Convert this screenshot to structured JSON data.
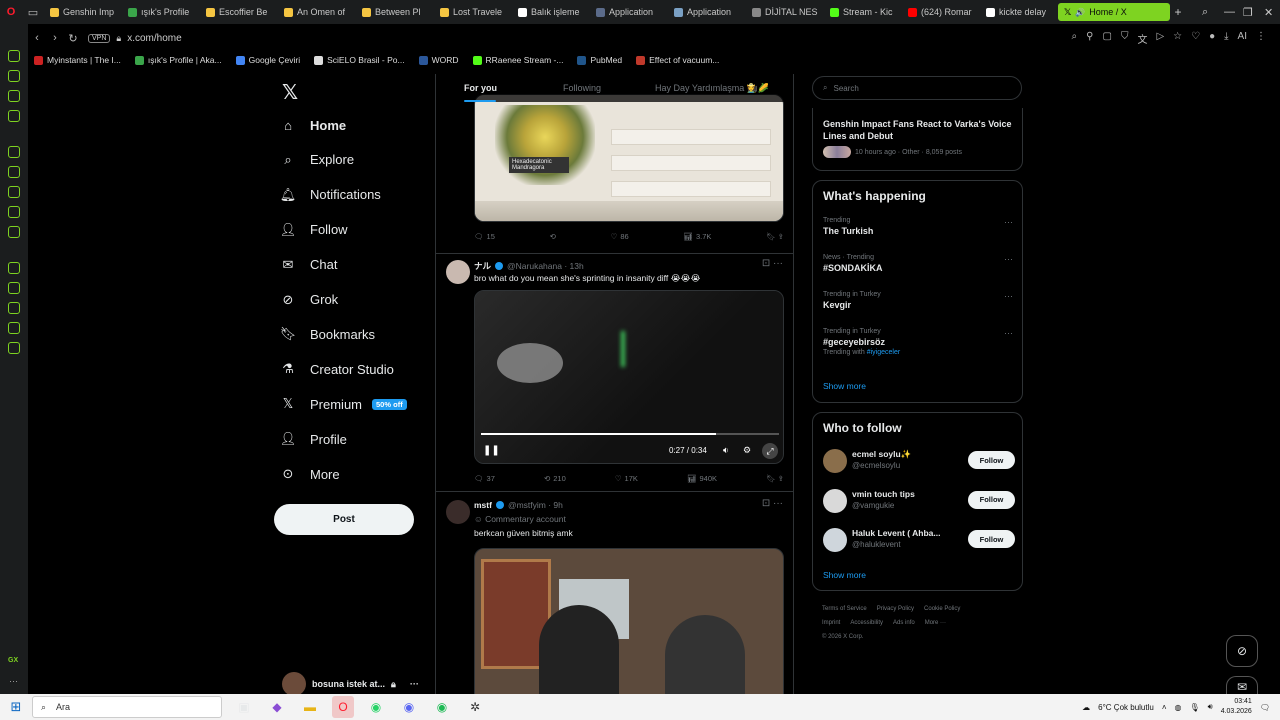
{
  "browser": {
    "tabs": [
      {
        "label": "Genshin Imp",
        "color": "#f5c542"
      },
      {
        "label": "ışık's Profile",
        "color": "#3aa54a"
      },
      {
        "label": "Escoffier Be",
        "color": "#f5c542"
      },
      {
        "label": "An Omen of",
        "color": "#f5c542"
      },
      {
        "label": "Between Pl",
        "color": "#f5c542"
      },
      {
        "label": "Lost Travele",
        "color": "#f5c542"
      },
      {
        "label": "Balık işleme",
        "color": "#ffffff"
      },
      {
        "label": "Application",
        "color": "#5b6b8a"
      },
      {
        "label": "Application",
        "color": "#7aa0c4"
      },
      {
        "label": "DİJİTAL NES",
        "color": "#888888"
      },
      {
        "label": "Stream - Kic",
        "color": "#53fc18"
      },
      {
        "label": "(624) Romar",
        "color": "#ff0000"
      },
      {
        "label": "kickte delay",
        "color": "#ffffff"
      }
    ],
    "active_tab": "Home / X",
    "address": "x.com/home",
    "vpn_label": "VPN",
    "ai_label": "AI",
    "bookmarks": [
      {
        "label": "Myinstants | The I...",
        "color": "#cc2222"
      },
      {
        "label": "ışık's Profile | Aka...",
        "color": "#3aa54a"
      },
      {
        "label": "Google Çeviri",
        "color": "#4285f4"
      },
      {
        "label": "SciELO Brasil - Po...",
        "color": "#dddddd"
      },
      {
        "label": "WORD",
        "color": "#2b579a"
      },
      {
        "label": "RRaenee Stream -...",
        "color": "#53fc18"
      },
      {
        "label": "PubMed",
        "color": "#20558a"
      },
      {
        "label": "Effect of vacuum...",
        "color": "#c0392b"
      }
    ]
  },
  "nav": {
    "items": [
      {
        "label": "Home",
        "icon": "home-icon"
      },
      {
        "label": "Explore",
        "icon": "search-icon"
      },
      {
        "label": "Notifications",
        "icon": "bell-icon"
      },
      {
        "label": "Follow",
        "icon": "person-add-icon"
      },
      {
        "label": "Chat",
        "icon": "mail-icon"
      },
      {
        "label": "Grok",
        "icon": "grok-icon"
      },
      {
        "label": "Bookmarks",
        "icon": "bookmark-icon"
      },
      {
        "label": "Creator Studio",
        "icon": "flask-icon"
      },
      {
        "label": "Premium",
        "icon": "x-icon"
      },
      {
        "label": "Profile",
        "icon": "person-icon"
      },
      {
        "label": "More",
        "icon": "more-icon"
      }
    ],
    "premium_badge": "50% off",
    "post_button": "Post",
    "account_name": "bosuna istek at..."
  },
  "feed": {
    "tabs": [
      "For you",
      "Following",
      "Hay Day Yardımlaşma 👩‍🌾🌽"
    ],
    "tweet1": {
      "media_label": "Hexadecatonic Mandragora",
      "replies": "15",
      "retweets": "",
      "likes": "86",
      "views": "3.7K"
    },
    "tweet2": {
      "name": "ナル",
      "handle": "@Narukahana · 13h",
      "text": "bro what do you mean she's sprinting in insanity diff 😭😭😭",
      "video_time": "0:27 / 0:34",
      "progress": 0.79,
      "replies": "37",
      "retweets": "210",
      "likes": "17K",
      "views": "940K"
    },
    "tweet3": {
      "name": "mstf",
      "handle": "@mstfyim · 9h",
      "context": "Commentary account",
      "text": "berkcan güven bitmiş amk"
    }
  },
  "right": {
    "search_placeholder": "Search",
    "news": {
      "title": "Genshin Impact Fans React to Varka's Voice Lines and Debut",
      "meta": "10 hours ago · Other · 8,059 posts"
    },
    "happening_title": "What's happening",
    "trends": [
      {
        "context": "Trending",
        "topic": "The Turkish",
        "with": ""
      },
      {
        "context": "News · Trending",
        "topic": "#SONDAKİKA",
        "with": ""
      },
      {
        "context": "Trending in Turkey",
        "topic": "Kevgir",
        "with": ""
      },
      {
        "context": "Trending in Turkey",
        "topic": "#geceyebirsöz",
        "with_prefix": "Trending with",
        "with": "#iyigeceler"
      }
    ],
    "show_more": "Show more",
    "wtf_title": "Who to follow",
    "follow": [
      {
        "name": "ecmel soylu✨",
        "handle": "@ecmelsoylu",
        "color": "#8a6e4b"
      },
      {
        "name": "vmin touch tips",
        "handle": "@vamgukie",
        "color": "#d9d9d9"
      },
      {
        "name": "Haluk Levent ( Ahba...",
        "handle": "@haluklevent",
        "color": "#cfd6dc"
      }
    ],
    "follow_label": "Follow",
    "footer": [
      "Terms of Service",
      "Privacy Policy",
      "Cookie Policy",
      "Imprint",
      "Accessibility",
      "Ads info",
      "More ···",
      "© 2026 X Corp."
    ]
  },
  "taskbar": {
    "search": "Ara",
    "weather": "6°C  Çok bulutlu",
    "time": "03:41",
    "date": "4.03.2026"
  }
}
